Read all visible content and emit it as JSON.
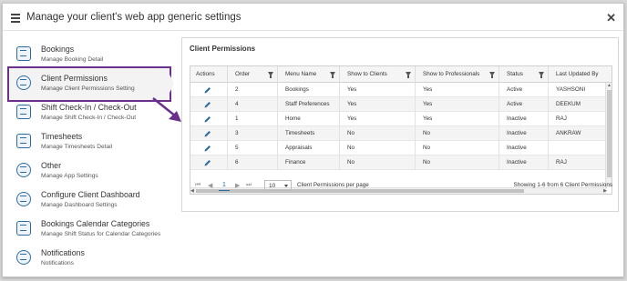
{
  "window": {
    "title": "Manage your client's web app generic settings"
  },
  "colors": {
    "accent": "#2d6ca2",
    "highlight": "#6b2f8c"
  },
  "sidebar": {
    "items": [
      {
        "label": "Bookings",
        "sub": "Manage Booking Detail",
        "icon": "bookings-icon"
      },
      {
        "label": "Client Permissions",
        "sub": "Manage Client Permissions Setting",
        "icon": "permissions-icon"
      },
      {
        "label": "Shift Check-In / Check-Out",
        "sub": "Manage Shift Check-In / Check-Out",
        "icon": "check-in-icon"
      },
      {
        "label": "Timesheets",
        "sub": "Manage Timesheets Detail",
        "icon": "timesheets-icon"
      },
      {
        "label": "Other",
        "sub": "Manage App Settings",
        "icon": "list-icon"
      },
      {
        "label": "Configure Client Dashboard",
        "sub": "Manage Dashboard Settings",
        "icon": "dashboard-icon"
      },
      {
        "label": "Bookings Calendar Categories",
        "sub": "Manage Shift Status for Calendar Categories",
        "icon": "calendar-icon"
      },
      {
        "label": "Notifications",
        "sub": "Notifications",
        "icon": "bell-icon"
      }
    ]
  },
  "panel": {
    "title": "Client Permissions",
    "columns": [
      "Actions",
      "Order",
      "Menu Name",
      "Show to Clients",
      "Show to Professionals",
      "Status",
      "Last Updated By"
    ],
    "rows": [
      {
        "order": "2",
        "menu": "Bookings",
        "clients": "Yes",
        "pros": "Yes",
        "status": "Active",
        "updated": "YASHSONI"
      },
      {
        "order": "4",
        "menu": "Staff Preferences",
        "clients": "Yes",
        "pros": "Yes",
        "status": "Active",
        "updated": "DEEKUM"
      },
      {
        "order": "1",
        "menu": "Home",
        "clients": "Yes",
        "pros": "Yes",
        "status": "Inactive",
        "updated": "RAJ"
      },
      {
        "order": "3",
        "menu": "Timesheets",
        "clients": "No",
        "pros": "No",
        "status": "Inactive",
        "updated": "ANKRAW"
      },
      {
        "order": "5",
        "menu": "Appraisals",
        "clients": "No",
        "pros": "No",
        "status": "Inactive",
        "updated": ""
      },
      {
        "order": "6",
        "menu": "Finance",
        "clients": "No",
        "pros": "No",
        "status": "Inactive",
        "updated": "RAJ"
      }
    ],
    "pager": {
      "current_page": "1",
      "page_size": "10",
      "page_size_label": "Client Permissions per page",
      "info": "Showing 1-6 from 6 Client Permissions"
    }
  }
}
